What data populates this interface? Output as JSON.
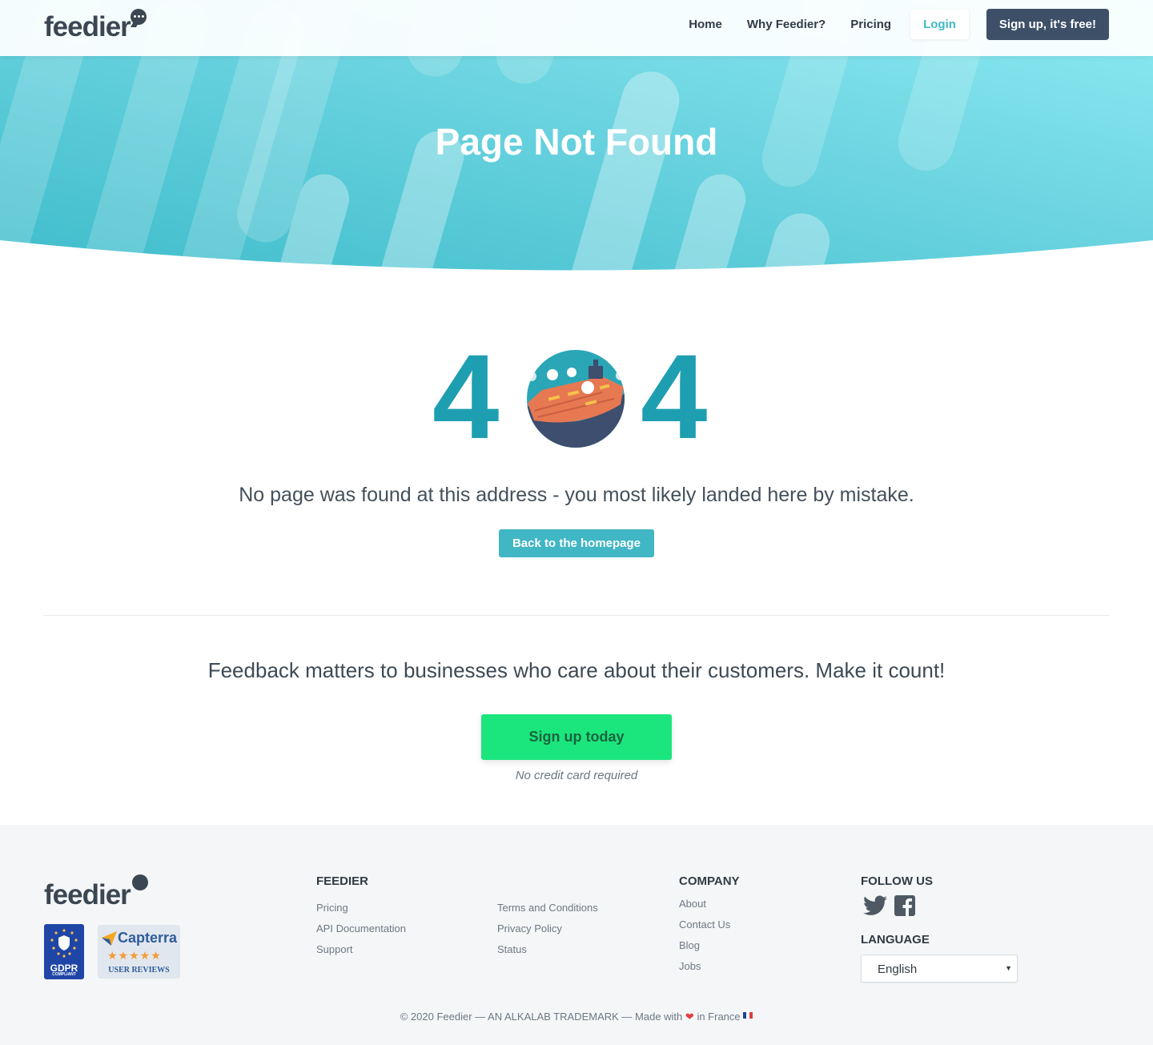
{
  "header": {
    "logo": "feedier",
    "nav": {
      "home": "Home",
      "why": "Why Feedier?",
      "pricing": "Pricing",
      "login": "Login",
      "signup": "Sign up, it's free!"
    }
  },
  "hero": {
    "title": "Page Not Found"
  },
  "error": {
    "digit_left": "4",
    "digit_right": "4",
    "message": "No page was found at this address - you most likely landed here by mistake.",
    "back_button": "Back to the homepage"
  },
  "cta": {
    "text": "Feedback matters to businesses who care about their customers. Make it count!",
    "button": "Sign up today",
    "note": "No credit card required"
  },
  "footer": {
    "logo": "feedier",
    "badges": {
      "gdpr_title": "GDPR",
      "gdpr_sub": "COMPLIANT",
      "capterra_name": "Capterra",
      "capterra_stars": "★★★★★",
      "capterra_sub": "USER REVIEWS"
    },
    "feedier_heading": "FEEDIER",
    "feedier_links": [
      "Pricing",
      "API Documentation",
      "Support"
    ],
    "legal_links": [
      "Terms and Conditions",
      "Privacy Policy",
      "Status"
    ],
    "company_heading": "COMPANY",
    "company_links": [
      "About",
      "Contact Us",
      "Blog",
      "Jobs"
    ],
    "follow_heading": "FOLLOW US",
    "language_heading": "LANGUAGE",
    "language_value": "English",
    "copyright_left": "© 2020 Feedier  —  AN ALKALAB TRADEMARK  —  Made with",
    "copyright_right": "in France"
  },
  "colors": {
    "accent": "#41b6c4",
    "digits": "#1e9fb1",
    "cta_green": "#1be67e",
    "signup_bg": "#3d5068"
  },
  "icons": [
    "feedier-logo-bubble",
    "ship-illustration",
    "twitter-icon",
    "facebook-icon",
    "heart-icon",
    "france-flag-icon",
    "gdpr-shield-icon",
    "capterra-logo-icon"
  ]
}
